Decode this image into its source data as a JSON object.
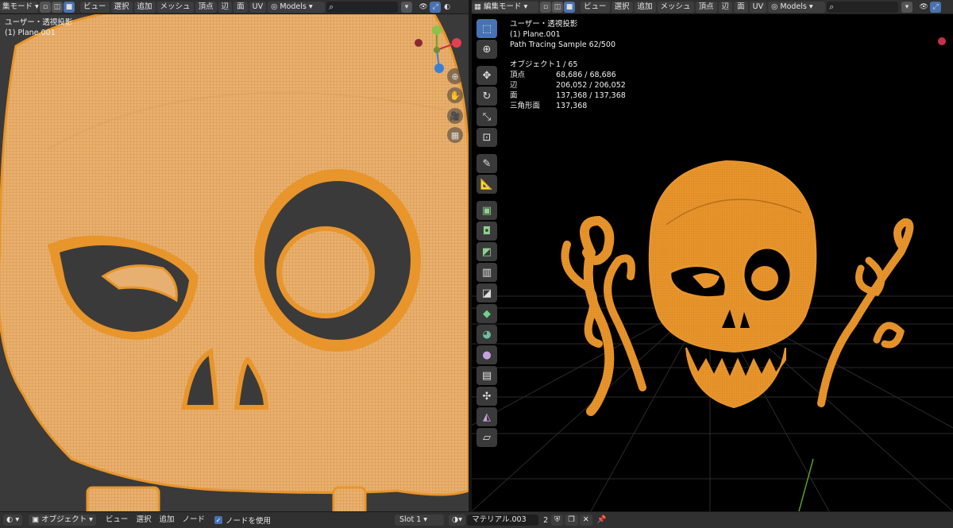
{
  "left_header": {
    "mode_label": "集モード",
    "menus": [
      "ビュー",
      "選択",
      "追加",
      "メッシュ",
      "頂点",
      "辺",
      "面",
      "UV"
    ],
    "models_label": "Models"
  },
  "right_header": {
    "mode_label": "編集モード",
    "menus": [
      "ビュー",
      "選択",
      "追加",
      "メッシュ",
      "頂点",
      "辺",
      "面",
      "UV"
    ],
    "models_label": "Models"
  },
  "left_viewport": {
    "view_name": "ユーザー・透視投影",
    "object_name": "(1) Plane.001"
  },
  "right_viewport": {
    "view_name": "ユーザー・透視投影",
    "object_name": "(1) Plane.001",
    "render_status": "Path Tracing Sample 62/500",
    "stats": [
      {
        "label": "オブジェクト",
        "value": "1 / 65"
      },
      {
        "label": "頂点",
        "value": "68,686 / 68,686"
      },
      {
        "label": "辺",
        "value": "206,052 / 206,052"
      },
      {
        "label": "面",
        "value": "137,368 / 137,368"
      },
      {
        "label": "三角形面",
        "value": "137,368"
      }
    ]
  },
  "nav_icons": [
    "zoom-icon",
    "hand-icon",
    "camera-icon",
    "grid-icon"
  ],
  "tools": [
    "select-box-icon",
    "cursor-icon",
    "move-icon",
    "rotate-icon",
    "scale-icon",
    "transform-icon",
    "annotate-icon",
    "measure-icon",
    "extrude-icon",
    "inset-icon",
    "bevel-icon",
    "loopcut-icon",
    "knife-icon",
    "polybuild-icon",
    "spin-icon",
    "smooth-icon",
    "edge-slide-icon",
    "shrink-icon",
    "shear-icon",
    "rip-icon"
  ],
  "footer": {
    "editor_mode": "オブジェクト",
    "menus": [
      "ビュー",
      "選択",
      "追加",
      "ノード"
    ],
    "use_nodes_label": "ノードを使用",
    "slot_label": "Slot 1",
    "material_name": "マテリアル.003",
    "user_count": "2"
  },
  "colors": {
    "mesh_orange": "#e8952c",
    "accent_blue": "#4772b3",
    "header_bg": "#303030"
  }
}
